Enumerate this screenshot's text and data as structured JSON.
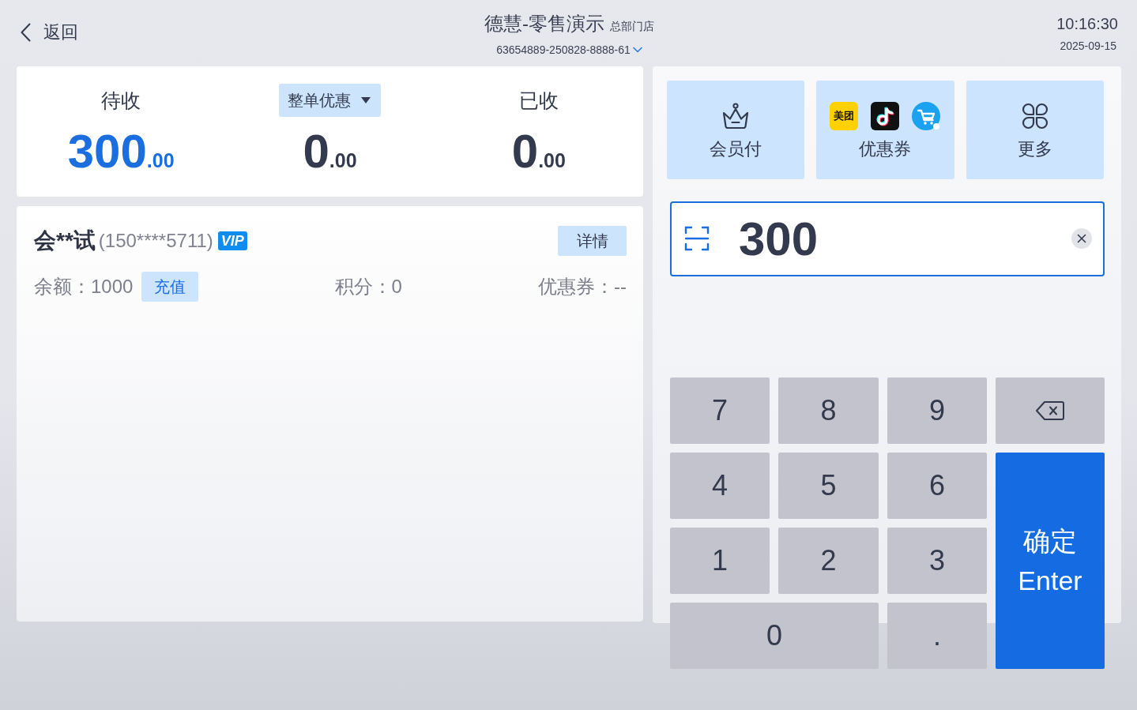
{
  "header": {
    "back": "返回",
    "title": "德慧-零售演示",
    "store": "总部门店",
    "order_no": "63654889-250828-8888-61",
    "time": "10:16:30",
    "date": "2025-09-15"
  },
  "summary": [
    {
      "kind": "label",
      "label": "待收",
      "amount": "300",
      "decimals": ".00",
      "highlight": true
    },
    {
      "kind": "dropdown",
      "label": "整单优惠",
      "amount": "0",
      "decimals": ".00",
      "highlight": false
    },
    {
      "kind": "label",
      "label": "已收",
      "amount": "0",
      "decimals": ".00",
      "highlight": false
    }
  ],
  "member": {
    "name": "会**试",
    "phone": "(150****5711)",
    "badge": "VIP",
    "details_button": "详情",
    "balance": "余额：1000",
    "recharge_button": "充值",
    "points": "积分：0",
    "coupons": "优惠券：--"
  },
  "payment_methods": [
    {
      "kind": "member",
      "label": "会员付"
    },
    {
      "kind": "coupon",
      "label": "优惠券",
      "logos": [
        {
          "kind": "text",
          "label": "美团"
        },
        {
          "kind": "note"
        },
        {
          "kind": "cart"
        }
      ]
    },
    {
      "kind": "more",
      "label": "更多"
    }
  ],
  "amount_input": {
    "value": "300"
  },
  "keypad": [
    {
      "kind": "digit",
      "label": "7"
    },
    {
      "kind": "digit",
      "label": "8"
    },
    {
      "kind": "digit",
      "label": "9"
    },
    {
      "kind": "delete"
    },
    {
      "kind": "digit",
      "label": "4"
    },
    {
      "kind": "digit",
      "label": "5"
    },
    {
      "kind": "digit",
      "label": "6"
    },
    {
      "kind": "digit",
      "label": "1"
    },
    {
      "kind": "digit",
      "label": "2"
    },
    {
      "kind": "digit",
      "label": "3"
    },
    {
      "kind": "enter",
      "label": "确定",
      "sublabel": "Enter"
    },
    {
      "kind": "wide",
      "label": "0"
    },
    {
      "kind": "digit",
      "label": "."
    }
  ]
}
